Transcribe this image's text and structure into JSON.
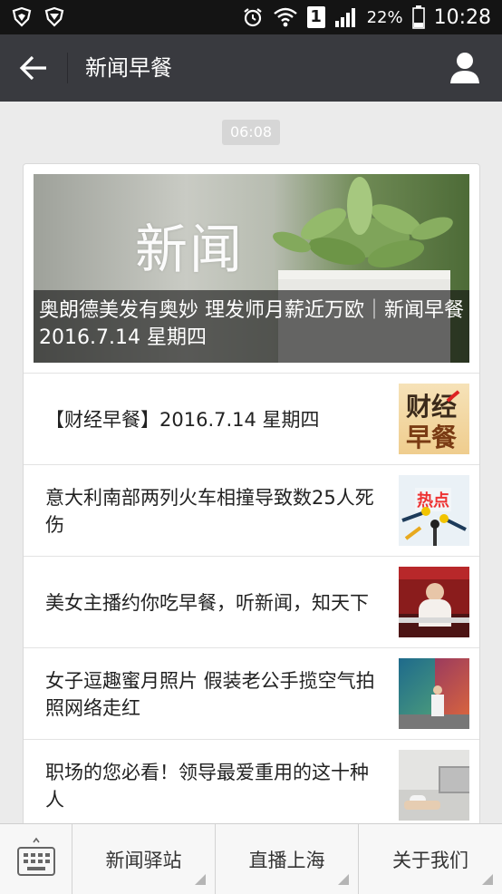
{
  "statusbar": {
    "battery_percent": "22%",
    "clock": "10:28",
    "sim_number": "1",
    "icons": [
      "shield-icon",
      "shield-icon",
      "alarm-icon",
      "wifi-icon",
      "sim-icon",
      "signal-icon",
      "battery-icon"
    ]
  },
  "navbar": {
    "title": "新闻早餐",
    "back_icon": "arrow-left-icon",
    "profile_icon": "user-icon"
  },
  "time_badge": "06:08",
  "hero": {
    "image_word": "新闻",
    "caption": "奥朗德美发有奥妙 理发师月薪近万欧｜新闻早餐 2016.7.14 星期四"
  },
  "articles": [
    {
      "title": "【财经早餐】2016.7.14 星期四",
      "thumb_line1": "财经",
      "thumb_line2": "早餐"
    },
    {
      "title": "意大利南部两列火车相撞导致数25人死伤",
      "thumb_text": "热点"
    },
    {
      "title": "美女主播约你吃早餐，听新闻，知天下"
    },
    {
      "title": "女子逗趣蜜月照片 假装老公手揽空气拍照网络走红"
    },
    {
      "title": "职场的您必看！领导最爱重用的这十种人"
    }
  ],
  "bottom_menu": {
    "keyboard_icon": "keyboard-icon",
    "items": [
      "新闻驿站",
      "直播上海",
      "关于我们"
    ]
  },
  "colors": {
    "navbar": "#393a3f",
    "statusbar": "#141414",
    "background": "#ebebeb"
  }
}
